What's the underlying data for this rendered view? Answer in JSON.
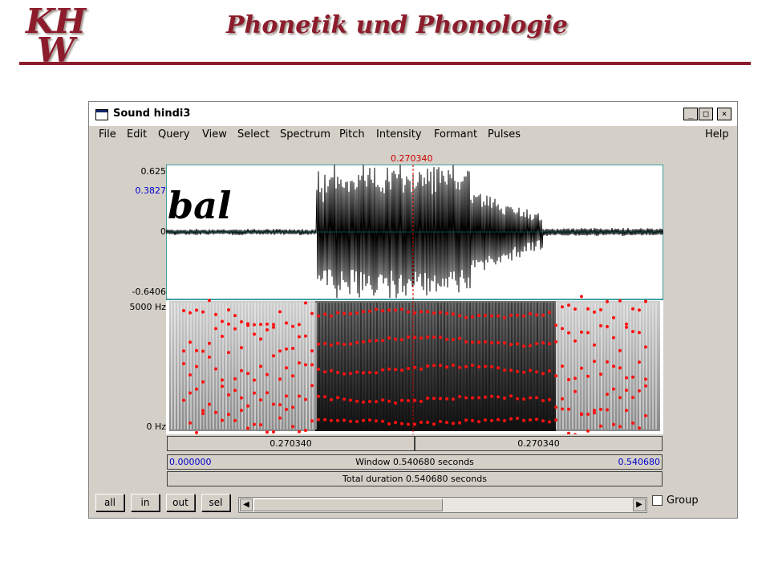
{
  "slide": {
    "logo_line1": "KH",
    "logo_line2": "W",
    "title": "Phonetik und Phonologie",
    "accent": "#8c1c2c"
  },
  "window": {
    "title": "Sound hindi3",
    "icon": "praat-window-icon",
    "controls": {
      "minimize": "_",
      "maximize": "□",
      "close": "×"
    }
  },
  "menus": [
    "File",
    "Edit",
    "Query",
    "View",
    "Select",
    "Spectrum",
    "Pitch",
    "Intensity",
    "Formant",
    "Pulses",
    "Help"
  ],
  "waveform": {
    "cursor_time": "0.270340",
    "y_max": "0.625",
    "y_cursor": "0.3827",
    "y_zero": "0",
    "y_min": "-0.6406",
    "annotation": "bal"
  },
  "spectrogram": {
    "freq_top": "5000 Hz",
    "freq_bottom": "0 Hz"
  },
  "selection": {
    "left": "0.270340",
    "right": "0.270340"
  },
  "window_bar": {
    "start": "0.000000",
    "label": "Window 0.540680 seconds",
    "end": "0.540680"
  },
  "total_bar": {
    "label": "Total duration 0.540680 seconds"
  },
  "buttons": {
    "all": "all",
    "in": "in",
    "out": "out",
    "sel": "sel"
  },
  "group_label": "Group",
  "colors": {
    "marker": "#cc0000",
    "formant": "#ff1010",
    "axis_blue": "#0000cc",
    "waveform_frame": "#008080"
  }
}
